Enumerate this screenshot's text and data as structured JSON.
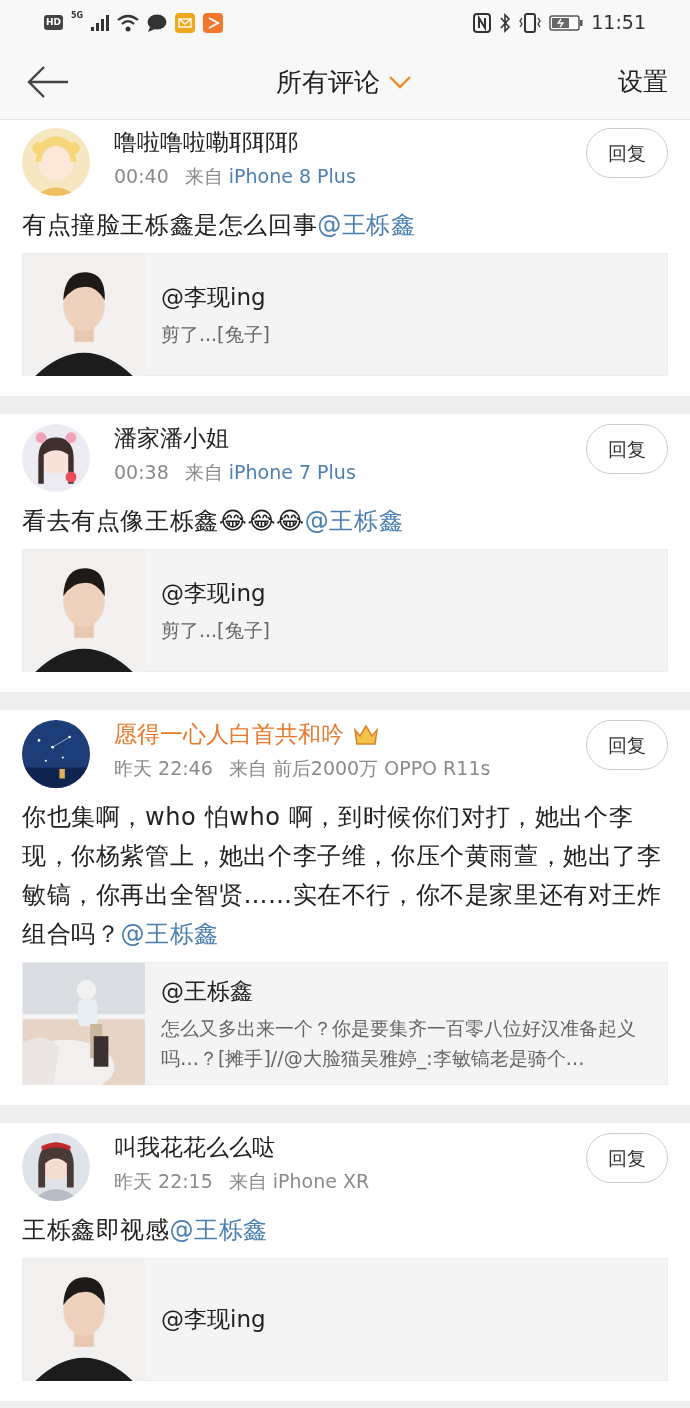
{
  "status_bar": {
    "hd": "HD",
    "network": "5G",
    "time": "11:51"
  },
  "header": {
    "title": "所有评论",
    "settings": "设置"
  },
  "comments": [
    {
      "name": "噜啦噜啦嘞耶耶耶",
      "vip": false,
      "time": "00:40",
      "from": "来自",
      "source": "iPhone 8 Plus",
      "source_link": true,
      "reply": "回复",
      "text": "有点撞脸王栎鑫是怎么回事",
      "mention": "@王栎鑫",
      "quote": {
        "title": "@李现ing",
        "subtitle": "剪了...[兔子]"
      }
    },
    {
      "name": "潘家潘小姐",
      "vip": false,
      "time": "00:38",
      "from": "来自",
      "source": "iPhone 7 Plus",
      "source_link": true,
      "reply": "回复",
      "text": "看去有点像王栎鑫😂😂😂",
      "mention": "@王栎鑫",
      "quote": {
        "title": "@李现ing",
        "subtitle": "剪了...[兔子]"
      }
    },
    {
      "name": "愿得一心人白首共和吟",
      "vip": true,
      "time": "昨天 22:46",
      "from": "来自",
      "source": "前后2000万 OPPO R11s",
      "source_link": false,
      "reply": "回复",
      "text": "你也集啊，who 怕who 啊，到时候你们对打，她出个李现，你杨紫管上，她出个李子维，你压个黄雨萱，她出了李敏镐，你再出全智贤……实在不行，你不是家里还有对王炸组合吗？",
      "mention": "@王栎鑫",
      "quote": {
        "title": "@王栎鑫",
        "subtitle": "怎么又多出来一个？你是要集齐一百零八位好汉准备起义吗…？[摊手]//@大脸猫吴雅婷_:李敏镐老是骑个…"
      }
    },
    {
      "name": "叫我花花么么哒",
      "vip": false,
      "time": "昨天 22:15",
      "from": "来自",
      "source": "iPhone XR",
      "source_link": false,
      "reply": "回复",
      "text": "王栎鑫即视感",
      "mention": "@王栎鑫",
      "quote": {
        "title": "@李现ing"
      }
    }
  ]
}
